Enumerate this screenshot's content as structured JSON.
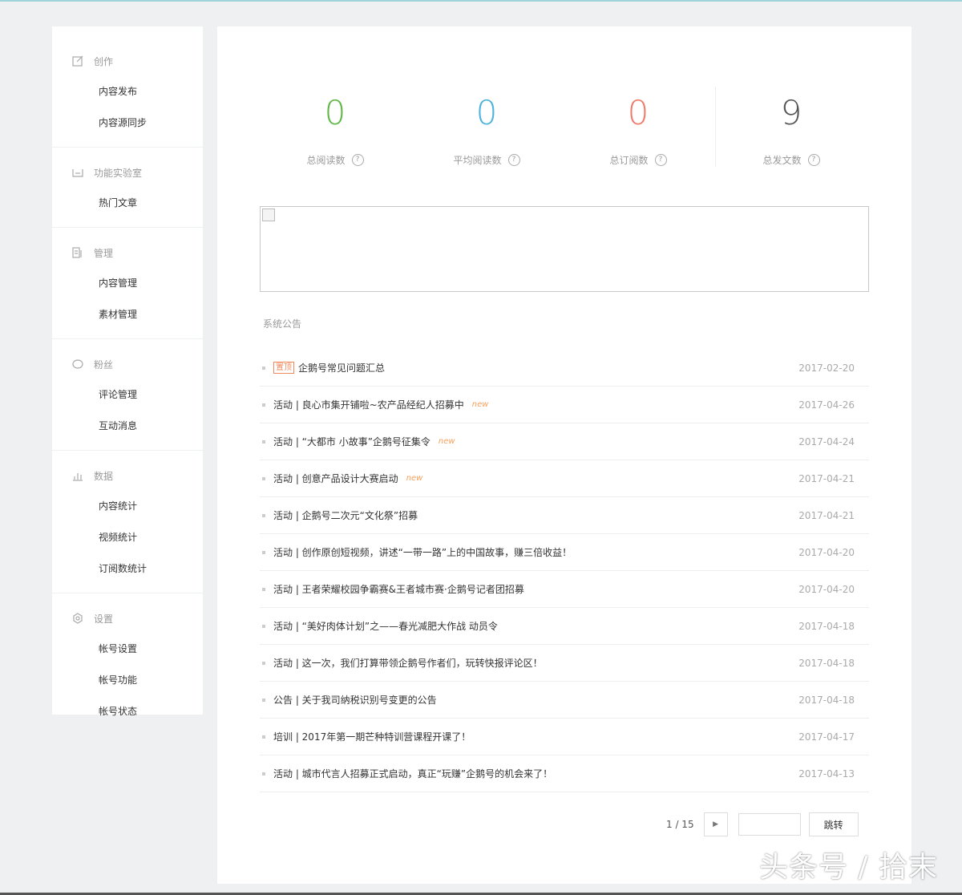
{
  "sidebar": {
    "groups": [
      {
        "title": "创作",
        "icon": "edit-icon",
        "items": [
          "内容发布",
          "内容源同步"
        ]
      },
      {
        "title": "功能实验室",
        "icon": "lab-icon",
        "items": [
          "热门文章"
        ]
      },
      {
        "title": "管理",
        "icon": "manage-icon",
        "items": [
          "内容管理",
          "素材管理"
        ]
      },
      {
        "title": "粉丝",
        "icon": "chat-icon",
        "items": [
          "评论管理",
          "互动消息"
        ]
      },
      {
        "title": "数据",
        "icon": "bar-chart-icon",
        "items": [
          "内容统计",
          "视频统计",
          "订阅数统计"
        ]
      },
      {
        "title": "设置",
        "icon": "gear-icon",
        "items": [
          "帐号设置",
          "帐号功能",
          "帐号状态"
        ]
      }
    ]
  },
  "stats": [
    {
      "value": "0",
      "label": "总阅读数",
      "color": "#5fb845"
    },
    {
      "value": "0",
      "label": "平均阅读数",
      "color": "#4fb2dd"
    },
    {
      "value": "0",
      "label": "总订阅数",
      "color": "#ef7c6a"
    },
    {
      "value": "9",
      "label": "总发文数",
      "color": "#555555"
    }
  ],
  "help_glyph": "?",
  "notice": {
    "title": "系统公告",
    "top_tag": "置顶",
    "new_label": "new",
    "rows": [
      {
        "text": "企鹅号常见问题汇总",
        "date": "2017-02-20",
        "top": true,
        "new": false
      },
      {
        "text": "活动 | 良心市集开铺啦~农产品经纪人招募中",
        "date": "2017-04-26",
        "top": false,
        "new": true
      },
      {
        "text": "活动 | “大都市 小故事”企鹅号征集令",
        "date": "2017-04-24",
        "top": false,
        "new": true
      },
      {
        "text": "活动 | 创意产品设计大赛启动",
        "date": "2017-04-21",
        "top": false,
        "new": true
      },
      {
        "text": "活动 | 企鹅号二次元“文化祭”招募",
        "date": "2017-04-21",
        "top": false,
        "new": false
      },
      {
        "text": "活动 | 创作原创短视频，讲述“一带一路”上的中国故事，赚三倍收益！",
        "date": "2017-04-20",
        "top": false,
        "new": false
      },
      {
        "text": "活动 | 王者荣耀校园争霸赛&王者城市赛·企鹅号记者团招募",
        "date": "2017-04-20",
        "top": false,
        "new": false
      },
      {
        "text": "活动 | “美好肉体计划”之——春光减肥大作战 动员令",
        "date": "2017-04-18",
        "top": false,
        "new": false
      },
      {
        "text": "活动 | 这一次，我们打算带领企鹅号作者们，玩转快报评论区！",
        "date": "2017-04-18",
        "top": false,
        "new": false
      },
      {
        "text": "公告 | 关于我司纳税识别号变更的公告",
        "date": "2017-04-18",
        "top": false,
        "new": false
      },
      {
        "text": "培训 | 2017年第一期芒种特训营课程开课了！",
        "date": "2017-04-17",
        "top": false,
        "new": false
      },
      {
        "text": "活动 | 城市代言人招募正式启动，真正“玩赚”企鹅号的机会来了！",
        "date": "2017-04-13",
        "top": false,
        "new": false
      }
    ]
  },
  "pager": {
    "info": "1 / 15",
    "next_glyph": "▶",
    "jump_label": "跳转"
  },
  "watermark": "头条号 / 拾末"
}
